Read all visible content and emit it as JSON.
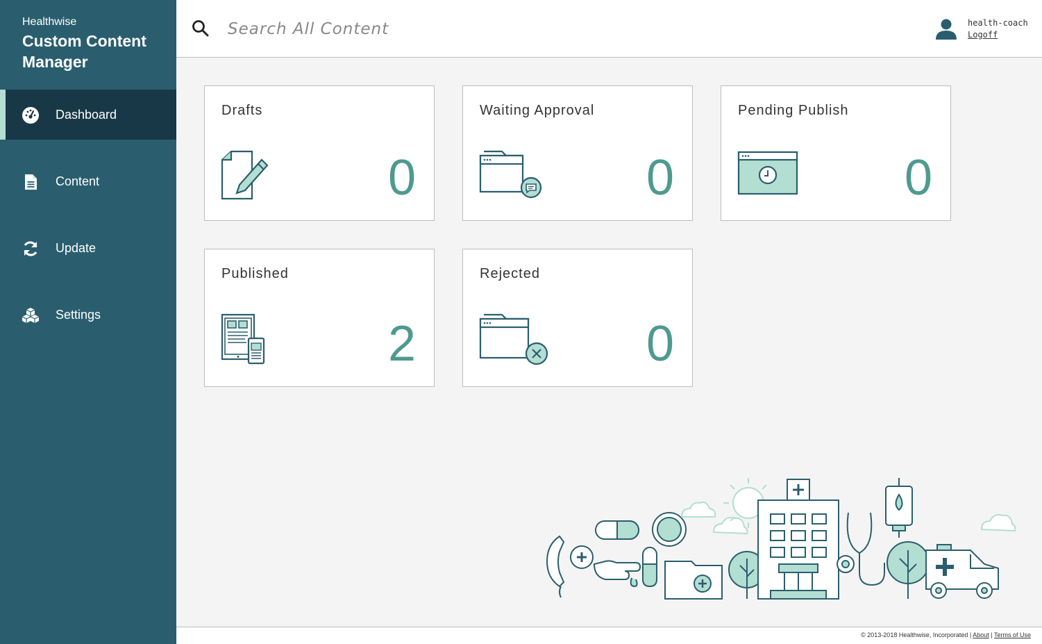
{
  "sidebar": {
    "brand_small": "Healthwise",
    "brand_title": "Custom Content Manager",
    "items": [
      {
        "label": "Dashboard",
        "icon": "dashboard-gauge-icon"
      },
      {
        "label": "Content",
        "icon": "document-icon"
      },
      {
        "label": "Update",
        "icon": "refresh-icon"
      },
      {
        "label": "Settings",
        "icon": "cubes-icon"
      }
    ],
    "active": "Dashboard"
  },
  "header": {
    "search_placeholder": "Search All Content",
    "user_name": "health-coach",
    "logoff_label": "Logoff"
  },
  "cards": [
    {
      "title": "Drafts",
      "count": "0",
      "icon": "draft-document-pencil-icon"
    },
    {
      "title": "Waiting Approval",
      "count": "0",
      "icon": "folder-comment-icon"
    },
    {
      "title": "Pending Publish",
      "count": "0",
      "icon": "browser-clock-icon"
    },
    {
      "title": "Published",
      "count": "2",
      "icon": "tablet-phone-icon"
    },
    {
      "title": "Rejected",
      "count": "0",
      "icon": "folder-reject-icon"
    }
  ],
  "footer": {
    "copyright": "© 2013-2018 Healthwise, Incorporated |",
    "about": "About",
    "separator": "|",
    "terms": "Terms of Use"
  },
  "colors": {
    "sidebar": "#2a5e6e",
    "sidebar_active": "#193847",
    "accent": "#4e9a8f",
    "icon_fill": "#b3ded2",
    "icon_stroke": "#2a5e6e"
  }
}
